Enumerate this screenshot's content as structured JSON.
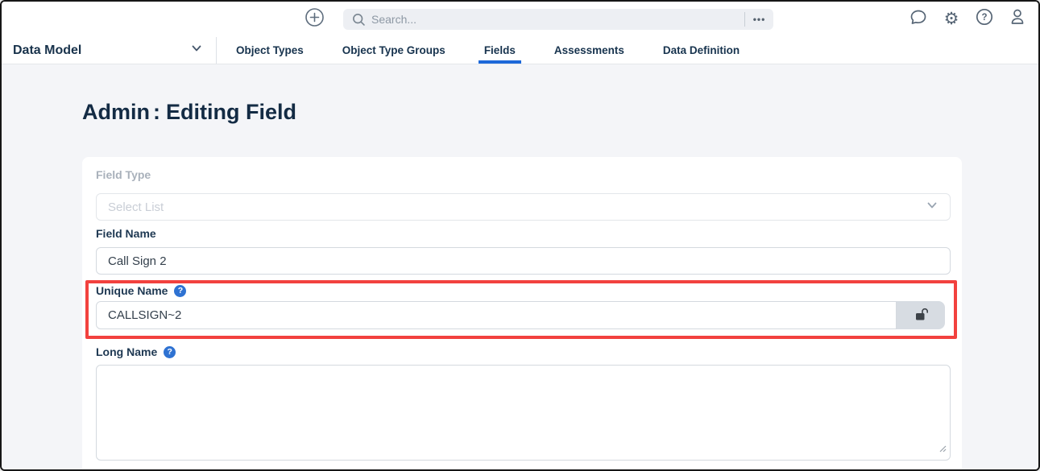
{
  "topbar": {
    "search": {
      "placeholder": "Search..."
    },
    "more_label": "•••"
  },
  "nav": {
    "context": {
      "label": "Data Model"
    },
    "tabs": [
      {
        "label": "Object Types",
        "active": false
      },
      {
        "label": "Object Type Groups",
        "active": false
      },
      {
        "label": "Fields",
        "active": true
      },
      {
        "label": "Assessments",
        "active": false
      },
      {
        "label": "Data Definition",
        "active": false
      }
    ]
  },
  "page": {
    "title_prefix": "Admin",
    "title_separator": ":",
    "title_text": "Editing Field"
  },
  "form": {
    "field_type": {
      "label": "Field Type",
      "placeholder": "Select List"
    },
    "field_name": {
      "label": "Field Name",
      "value": "Call Sign 2"
    },
    "unique_name": {
      "label": "Unique Name",
      "value": "CALLSIGN~2",
      "help": "?"
    },
    "long_name": {
      "label": "Long Name",
      "value": "",
      "help": "?"
    }
  },
  "colors": {
    "accent-blue": "#1d68d9",
    "help-blue": "#2e72d2",
    "highlight-red": "#f2413e"
  }
}
